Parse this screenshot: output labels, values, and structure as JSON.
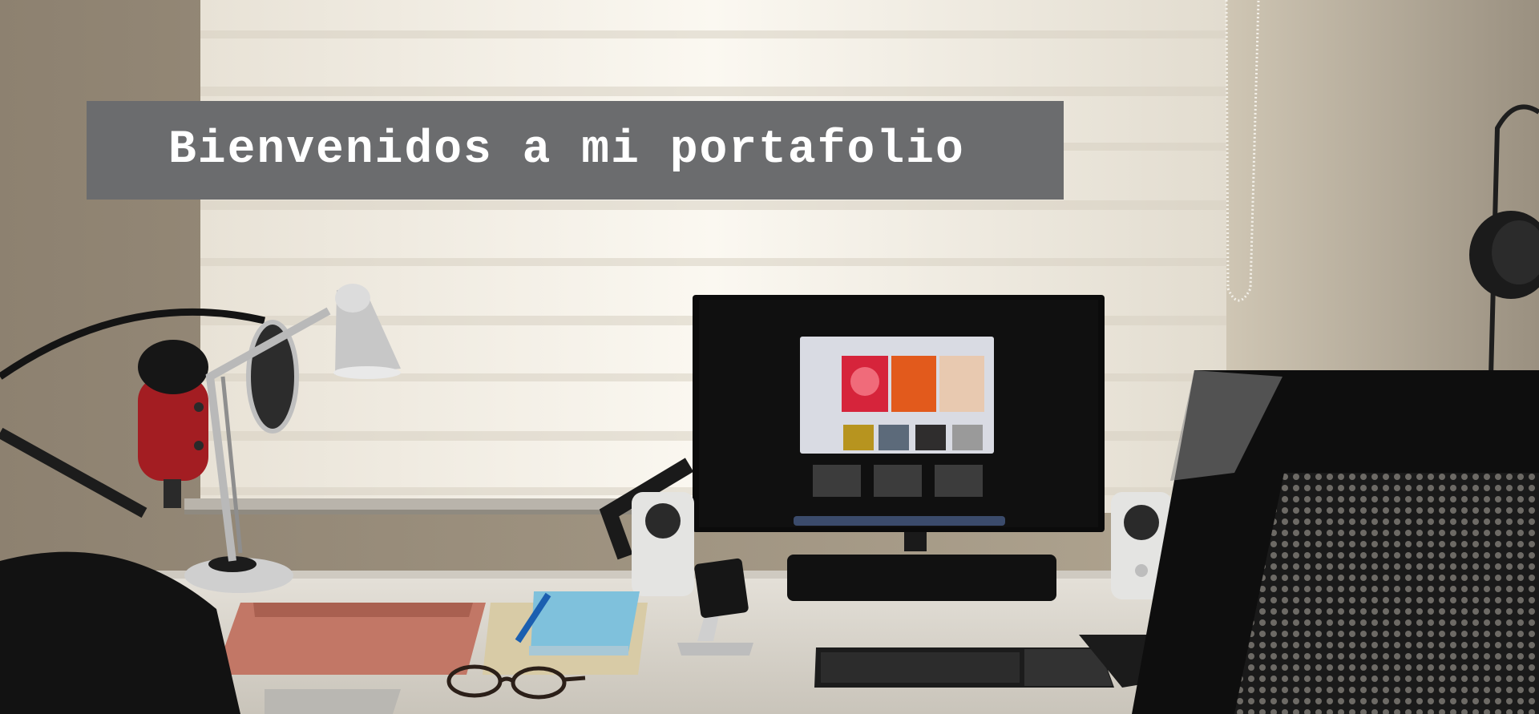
{
  "hero": {
    "title": "Bienvenidos a mi portafolio",
    "background": "photo-desk-setup-with-monitor-microphone-lamp-speakers"
  },
  "colors": {
    "banner": "#6b6c6e",
    "title_text": "#ffffff",
    "wall": "#a99d87",
    "window_light": "#f3eee3",
    "desk": "#dedad2"
  }
}
